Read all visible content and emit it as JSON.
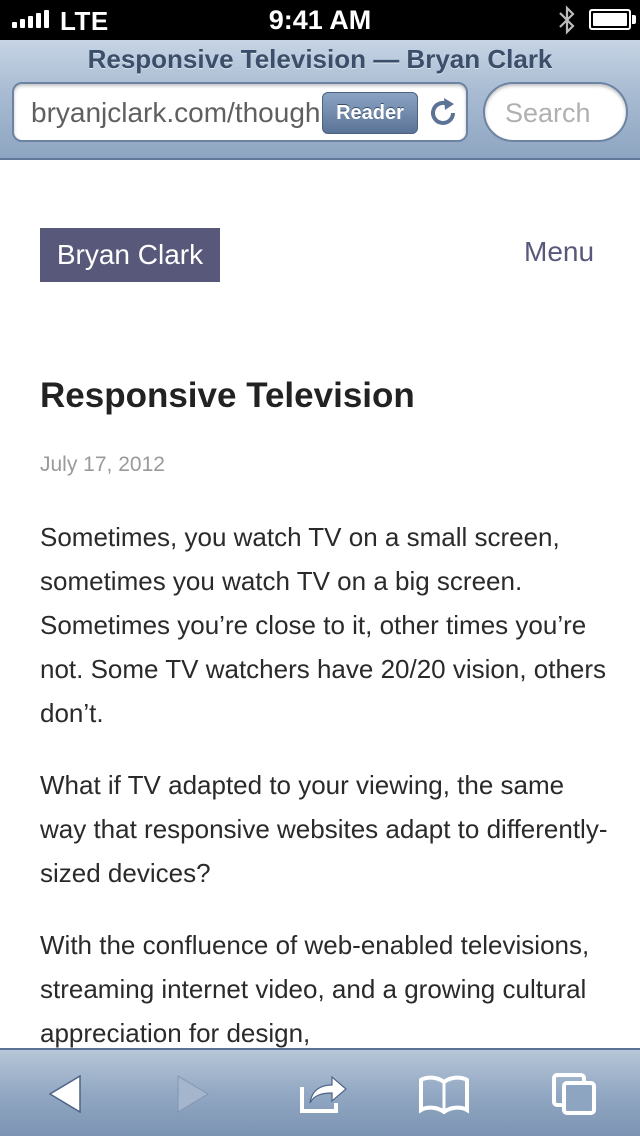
{
  "status_bar": {
    "carrier": "LTE",
    "time": "9:41 AM",
    "signal_bars": 5,
    "battery_level": 1.0,
    "icons": [
      "signal-bars-icon",
      "bluetooth-icon",
      "battery-icon"
    ]
  },
  "browser": {
    "page_title": "Responsive Television — Bryan Clark",
    "url": "bryanjclark.com/thoughts/responsive-television",
    "reader_label": "Reader",
    "search_placeholder": "Search",
    "toolbar_icons": [
      "back-icon",
      "forward-icon",
      "share-icon",
      "bookmarks-icon",
      "tabs-icon"
    ]
  },
  "site": {
    "name": "Bryan Clark",
    "menu_label": "Menu",
    "brand_color": "#58597a"
  },
  "article": {
    "title": "Responsive Television",
    "date": "July 17, 2012",
    "paragraphs": [
      "Sometimes, you watch TV on a small screen, sometimes you watch TV on a big screen. Sometimes you’re close to it, other times you’re not. Some TV watchers have 20/20 vision, others don’t.",
      "What if TV adapted to your viewing, the same way that responsive websites adapt to differently-sized devices?",
      "With the confluence of web-enabled televisions, streaming internet video, and a growing cultural appreciation for design,"
    ]
  }
}
